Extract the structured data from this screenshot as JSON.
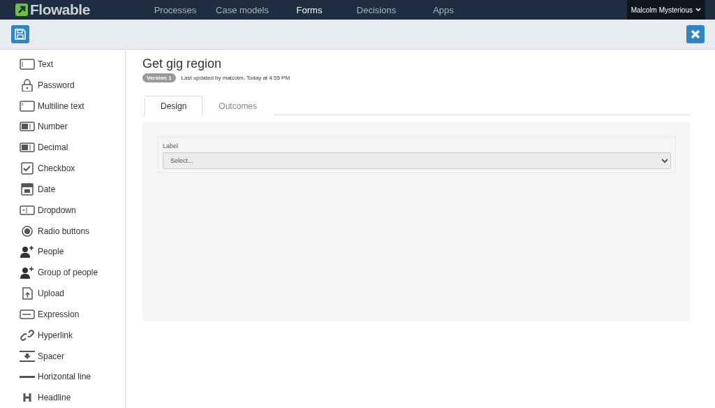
{
  "brand": "Flowable",
  "nav": [
    {
      "label": "Processes",
      "selected": false
    },
    {
      "label": "Case models",
      "selected": false
    },
    {
      "label": "Forms",
      "selected": true
    },
    {
      "label": "Decisions",
      "selected": false
    },
    {
      "label": "Apps",
      "selected": false
    }
  ],
  "user": "Malcolm Mysterious",
  "palette": [
    {
      "kind": "text",
      "label": "Text"
    },
    {
      "kind": "password",
      "label": "Password"
    },
    {
      "kind": "multiline",
      "label": "Multiline text"
    },
    {
      "kind": "number",
      "label": "Number"
    },
    {
      "kind": "decimal",
      "label": "Decimal"
    },
    {
      "kind": "checkbox",
      "label": "Checkbox"
    },
    {
      "kind": "date",
      "label": "Date"
    },
    {
      "kind": "dropdown",
      "label": "Dropdown"
    },
    {
      "kind": "radio",
      "label": "Radio buttons"
    },
    {
      "kind": "people",
      "label": "People"
    },
    {
      "kind": "people",
      "label": "Group of people"
    },
    {
      "kind": "upload",
      "label": "Upload"
    },
    {
      "kind": "expression",
      "label": "Expression"
    },
    {
      "kind": "hyperlink",
      "label": "Hyperlink"
    },
    {
      "kind": "spacer",
      "label": "Spacer"
    },
    {
      "kind": "line",
      "label": "Horizontal line"
    },
    {
      "kind": "headline",
      "label": "Headline"
    }
  ],
  "form": {
    "title": "Get gig region",
    "version": "Version 1",
    "updated": "Last updated by malcolm, Today at 4:55 PM"
  },
  "tabs": [
    {
      "label": "Design",
      "selected": true
    },
    {
      "label": "Outcomes",
      "selected": false
    }
  ],
  "field": {
    "label": "Label",
    "placeholder": "Select..."
  }
}
